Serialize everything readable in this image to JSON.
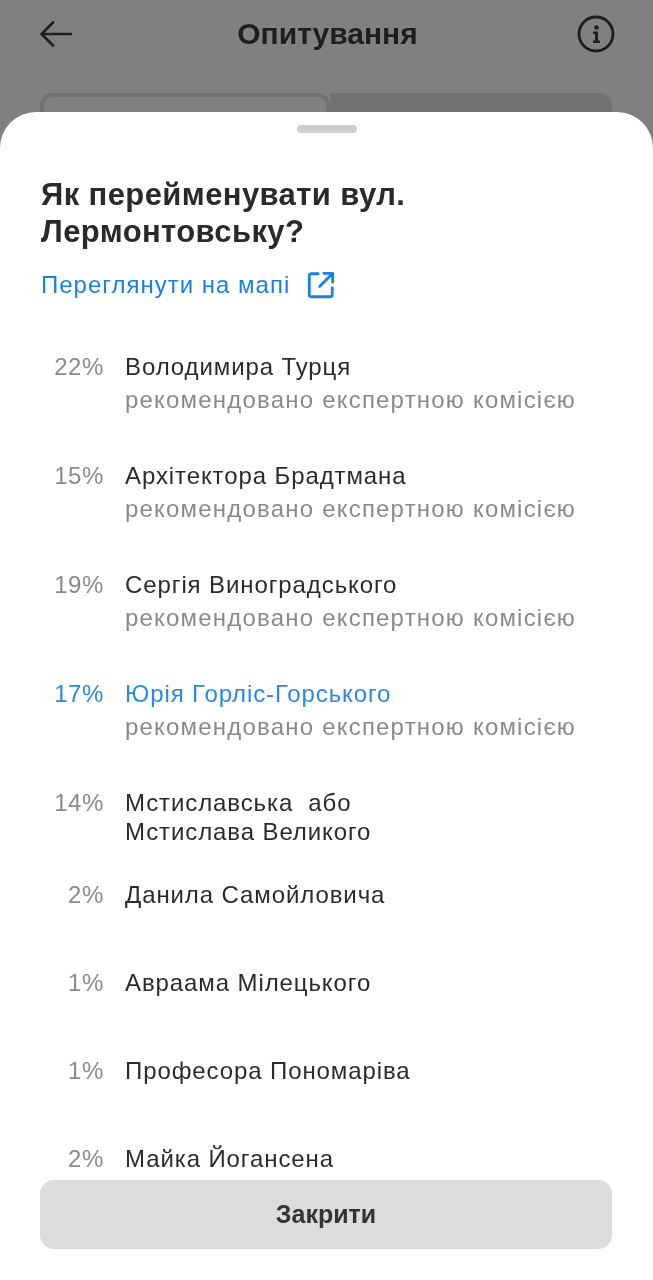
{
  "header": {
    "title": "Опитування"
  },
  "background_tabs": [
    {
      "selected": true
    },
    {
      "selected": false
    }
  ],
  "sheet": {
    "question": "Як перейменувати вул. Лермонтовську?",
    "map_link": "Переглянути на мапі",
    "options": [
      {
        "percent": "22%",
        "name": "Володимира Турця",
        "note": "рекомендовано експертною комісією",
        "selected": false
      },
      {
        "percent": "15%",
        "name": "Архітектора Брадтмана",
        "note": "рекомендовано експертною комісією",
        "selected": false
      },
      {
        "percent": "19%",
        "name": "Сергія Виноградського",
        "note": "рекомендовано експертною комісією",
        "selected": false
      },
      {
        "percent": "17%",
        "name": "Юрія Горліс-Горського",
        "note": "рекомендовано експертною комісією",
        "selected": true
      },
      {
        "percent": "14%",
        "name": "Мстиславська  або\nМстислава Великого",
        "selected": false
      },
      {
        "percent": "2%",
        "name": "Данила Самойловича",
        "selected": false
      },
      {
        "percent": "1%",
        "name": "Авраама Мілецького",
        "selected": false
      },
      {
        "percent": "1%",
        "name": "Професора Пономаріва",
        "selected": false
      },
      {
        "percent": "2%",
        "name": "Майка Йогансена",
        "selected": false
      }
    ],
    "close_button": "Закрити"
  }
}
